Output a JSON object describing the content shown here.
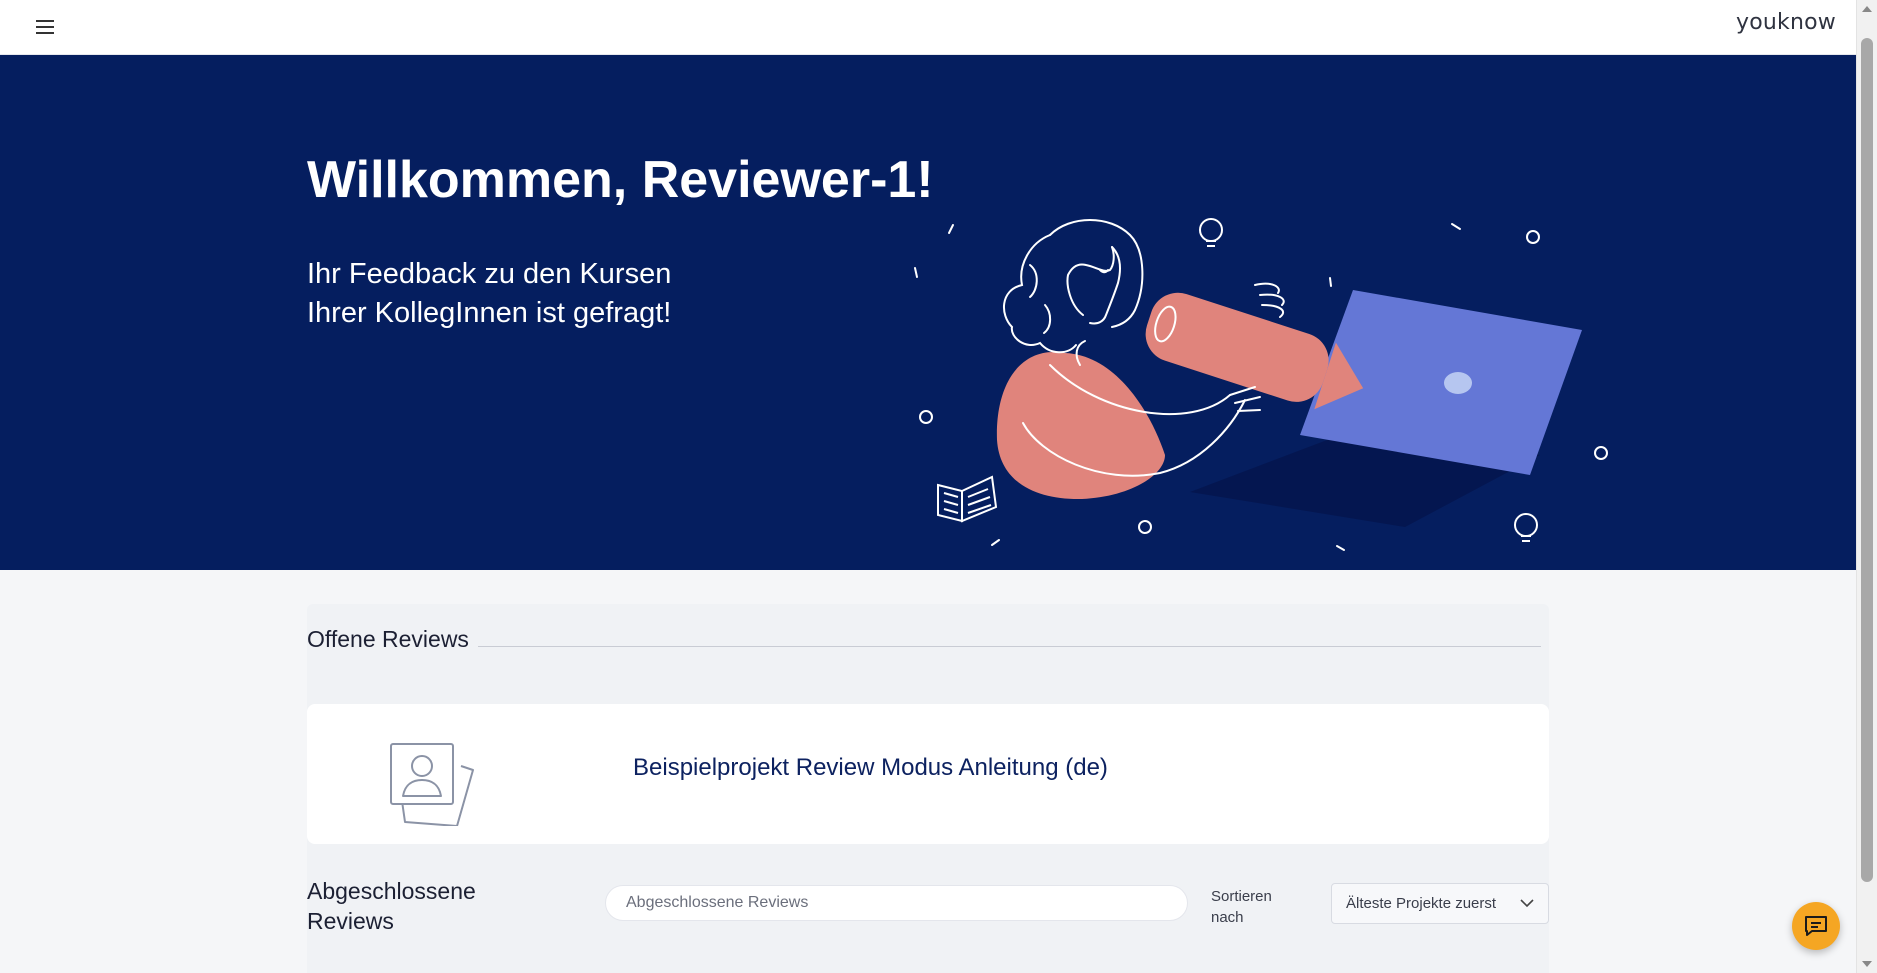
{
  "header": {
    "menu_icon": "hamburger-menu-icon",
    "brand": "youknow"
  },
  "hero": {
    "title": "Willkommen, Reviewer-1!",
    "subtitle_line1": "Ihr Feedback zu den Kursen",
    "subtitle_line2": "Ihrer KollegInnen ist gefragt!",
    "illustration": "person-with-pencil-and-laptop-illustration",
    "colors": {
      "background": "#051e5f",
      "pencil": "#e0847c",
      "laptop": "#6477d6"
    }
  },
  "open_reviews": {
    "title": "Offene Reviews",
    "items": [
      {
        "title": "Beispielprojekt Review Modus Anleitung (de)",
        "icon": "profile-card-placeholder-icon"
      }
    ]
  },
  "completed_reviews": {
    "title_line1": "Abgeschlossene",
    "title_line2": "Reviews",
    "search_placeholder": "Abgeschlossene Reviews",
    "sort_label_line1": "Sortieren",
    "sort_label_line2": "nach",
    "sort_selected": "Älteste Projekte zuerst",
    "sort_icon": "chevron-down-icon"
  },
  "chat": {
    "icon": "chat-bubble-icon",
    "color": "#f5a623"
  }
}
